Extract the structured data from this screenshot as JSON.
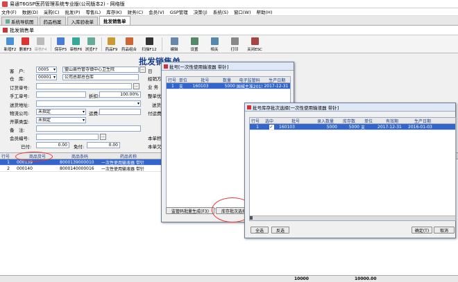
{
  "app": {
    "title": "易通T6GSP医药管理系统专业版(公司版本2) - 网络版",
    "menus": [
      "文件(F)",
      "数据(D)",
      "采购(C)",
      "批发(P)",
      "零售(L)",
      "库存(K)",
      "财务(C)",
      "会员(V)",
      "GSP管理",
      "决策(J)",
      "系统(S)",
      "窗口(W)",
      "帮助(H)"
    ]
  },
  "tabs": [
    {
      "label": "系统导航图"
    },
    {
      "label": "药品档案"
    },
    {
      "label": "入库验收单"
    },
    {
      "label": "批发销售单"
    }
  ],
  "subtitle": "批发销售单",
  "toolbar": [
    {
      "label": "新增F2",
      "color": "#4a90d9"
    },
    {
      "label": "删单F3",
      "color": "#d33"
    },
    {
      "label": "审核F4",
      "color": "#aaa"
    },
    {
      "label": "保存F5",
      "color": "#4a7bd9"
    },
    {
      "label": "审核F6",
      "color": "#3a9"
    },
    {
      "label": "浏览F7",
      "color": "#6a9"
    },
    {
      "label": "药品F9",
      "color": "#c93"
    },
    {
      "label": "药品组合",
      "color": "#c63"
    },
    {
      "label": "扫描F12",
      "color": "#333"
    },
    {
      "label": "编辑",
      "color": "#68a"
    },
    {
      "label": "设置",
      "color": "#586"
    },
    {
      "label": "相关",
      "color": "#58a"
    },
    {
      "label": "打印",
      "color": "#888"
    },
    {
      "label": "关闭ESC",
      "color": "#a44"
    }
  ],
  "form": {
    "title": "批发销售单",
    "customer_label": "客　户:",
    "customer_code": "0005",
    "customer_name": "盟山县竹管寺镇中心卫生院",
    "warehouse_label": "仓　库:",
    "warehouse_code": "00001",
    "warehouse_name": "公司总部总仓库",
    "order_no_label": "订货单号:",
    "manual_no_label": "手工单号:",
    "discount_label": "折扣:",
    "discount_value": "100.00%",
    "business_label": "业 务",
    "address_label": "送货地址:",
    "logistics_label": "物流公司:",
    "logistics_value": "未指定",
    "freight_label": "运费:",
    "invoice_label": "开票类型:",
    "invoice_value": "未指定",
    "remark_label": "备　注:",
    "member_label": "会员编号:",
    "paid_label": "已付:",
    "paid_value": "0.00",
    "free_label": "免付:",
    "free_value": "0.00",
    "right_labels": [
      "日",
      "经销方",
      "整单优",
      "送货",
      "付运费",
      "本单积",
      "本单欠"
    ]
  },
  "main_grid": {
    "headers": [
      "行号",
      "商品货号",
      "商品条码",
      "药品名称"
    ],
    "rows": [
      {
        "no": "1",
        "code": "000139",
        "barcode": "8000139000010",
        "name": "一次性使用输液器 带针"
      },
      {
        "no": "2",
        "code": "000140",
        "barcode": "8000140000016",
        "name": "一次性使用输液器 带针"
      }
    ]
  },
  "dialog1": {
    "title": "批号[一次性使用输液器 带针]",
    "headers": [
      "行号",
      "单位",
      "批号",
      "数量",
      "电子监管码",
      "生产日期",
      "有效期"
    ],
    "rows": [
      {
        "no": "1",
        "unit": "支",
        "batch": "160103",
        "qty": "5000",
        "code": "国械主准20153661203",
        "mfg": "2017-12-31",
        "exp": "2017-12-31"
      }
    ],
    "total": "5000",
    "btn_gen": "监管码批量生成(F3)",
    "btn_stock": "库存批次选择"
  },
  "dialog2": {
    "title": "批号库存批次选择[一次性使用输液器 带针]",
    "headers": [
      "行号",
      "选中",
      "批号",
      "录入数量",
      "库存数",
      "单位",
      "有效期",
      "生产日期"
    ],
    "rows": [
      {
        "no": "1",
        "checked": "✓",
        "batch": "160103",
        "input_qty": "5000",
        "stock": "5000",
        "unit": "支",
        "exp": "2017-12-31",
        "mfg": "2016-01-03"
      }
    ],
    "btn_all": "全选",
    "btn_invert": "反选",
    "btn_ok": "确定(T)",
    "btn_cancel": "取消"
  },
  "footer": {
    "qty_total": "10000",
    "amount_total": "10000.00"
  }
}
